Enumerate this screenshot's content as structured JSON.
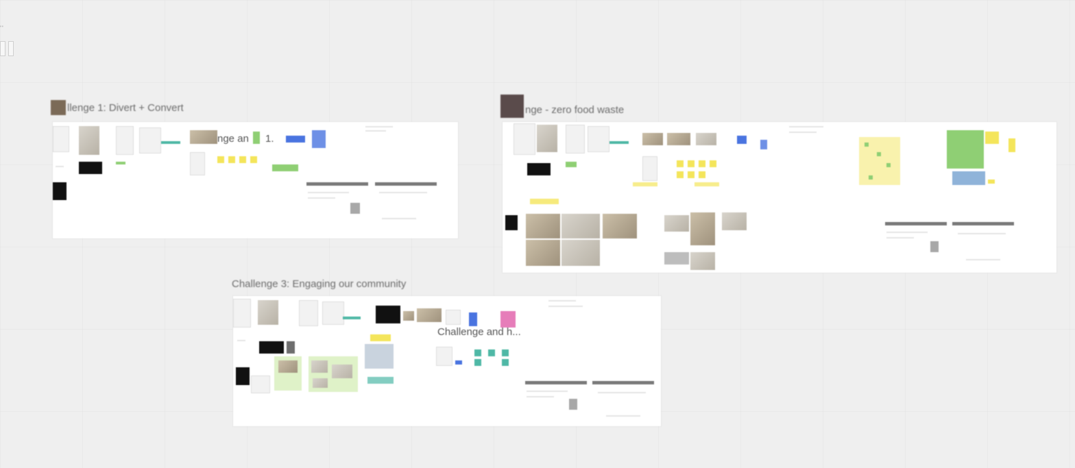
{
  "canvas": {
    "corner_label": "...",
    "background_color": "#efefef"
  },
  "frames": [
    {
      "title": "llenge 1: Divert + Convert"
    },
    {
      "title": "nge - zero food waste"
    },
    {
      "title": "Challenge 3: Engaging our community"
    }
  ],
  "inner_labels": {
    "frame1_overlay": "nge an",
    "frame1_overlay_num": "1.",
    "frame3_overlay": "Challenge and h..."
  }
}
